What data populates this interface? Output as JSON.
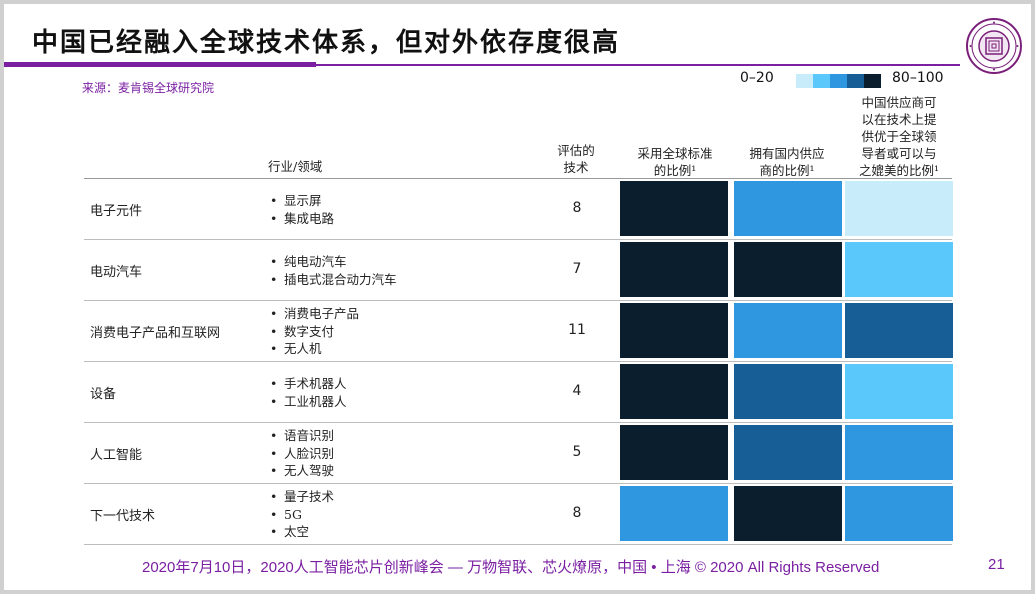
{
  "title": "中国已经融入全球技术体系，但对外依存度很高",
  "source": "来源：麦肯锡全球研究院",
  "legend": {
    "min_label": "0–20",
    "max_label": "80–100",
    "colors": [
      "#c9ecfb",
      "#5ac8fa",
      "#2f96e0",
      "#175e96",
      "#0a1e2e"
    ]
  },
  "headers": {
    "industry": "行业/领域",
    "count": [
      "评估的",
      "技术"
    ],
    "col1": [
      "采用全球标准",
      "的比例¹"
    ],
    "col2": [
      "拥有国内供应",
      "商的比例¹"
    ],
    "col3": [
      "中国供应商可",
      "以在技术上提",
      "供优于全球领",
      "导者或可以与",
      "之媲美的比例¹"
    ]
  },
  "rows": [
    {
      "industry": "电子元件",
      "techs": [
        "显示屏",
        "集成电路"
      ],
      "count": "8",
      "levels": [
        4,
        2,
        0
      ]
    },
    {
      "industry": "电动汽车",
      "techs": [
        "纯电动汽车",
        "插电式混合动力汽车"
      ],
      "count": "7",
      "levels": [
        4,
        4,
        1
      ]
    },
    {
      "industry": "消费电子产品和互联网",
      "techs": [
        "消费电子产品",
        "数字支付",
        "无人机"
      ],
      "count": "11",
      "levels": [
        4,
        2,
        3
      ]
    },
    {
      "industry": "设备",
      "techs": [
        "手术机器人",
        "工业机器人"
      ],
      "count": "4",
      "levels": [
        4,
        3,
        1
      ]
    },
    {
      "industry": "人工智能",
      "techs": [
        "语音识别",
        "人脸识别",
        "无人驾驶"
      ],
      "count": "5",
      "levels": [
        4,
        3,
        2
      ]
    },
    {
      "industry": "下一代技术",
      "techs": [
        "量子技术",
        "5G",
        "太空"
      ],
      "count": "8",
      "levels": [
        2,
        4,
        2
      ]
    }
  ],
  "footer": "2020年7月10日，2020人工智能芯片创新峰会 — 万物智联、芯火燎原，中国 • 上海 © 2020 All Rights Reserved",
  "page_number": "21"
}
